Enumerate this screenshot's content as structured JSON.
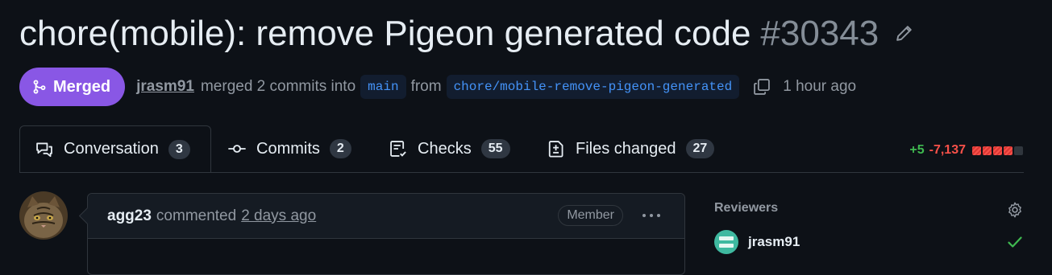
{
  "pr": {
    "title": "chore(mobile): remove Pigeon generated code",
    "number": "#30343",
    "status": "Merged",
    "author": "jrasm91",
    "merge_text": "merged 2 commits into",
    "base_branch": "main",
    "from_text": "from",
    "head_branch": "chore/mobile-remove-pigeon-generated",
    "time": "1 hour ago"
  },
  "tabs": [
    {
      "label": "Conversation",
      "count": "3",
      "icon": "conversation-icon"
    },
    {
      "label": "Commits",
      "count": "2",
      "icon": "commit-icon"
    },
    {
      "label": "Checks",
      "count": "55",
      "icon": "checklist-icon"
    },
    {
      "label": "Files changed",
      "count": "27",
      "icon": "file-diff-icon"
    }
  ],
  "diffstat": {
    "additions": "+5",
    "deletions": "-7,137",
    "deleted_blocks": 4,
    "neutral_blocks": 1
  },
  "comment": {
    "author": "agg23",
    "action": "commented",
    "time": "2 days ago",
    "role": "Member"
  },
  "sidebar": {
    "reviewers_title": "Reviewers",
    "reviewers": [
      {
        "name": "jrasm91",
        "status": "approved"
      }
    ]
  },
  "colors": {
    "merged": "#8957e5",
    "add": "#3fb950",
    "delete": "#f85149",
    "link": "#4493f8",
    "bg": "#0d1117"
  }
}
